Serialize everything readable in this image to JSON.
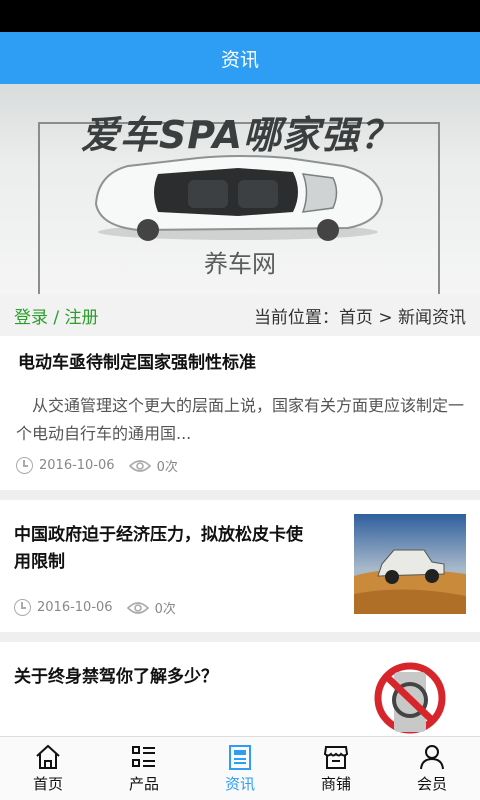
{
  "header": {
    "title": "资讯"
  },
  "banner": {
    "headline": "爱车SPA哪家强？",
    "caption": "养车网"
  },
  "breadcrumb": {
    "login": "登录",
    "separator": " / ",
    "register": "注册",
    "prefix": "当前位置：",
    "home": "首页",
    "arrow": " > ",
    "current": "新闻资讯"
  },
  "articles": [
    {
      "title": "电动车亟待制定国家强制性标准",
      "summary": "　从交通管理这个更大的层面上说，国家有关方面更应该制定一个电动自行车的通用国...",
      "date": "2016-10-06",
      "views": "0次"
    },
    {
      "title": "中国政府迫于经济压力，拟放松皮卡使用限制",
      "date": "2016-10-06",
      "views": "0次"
    },
    {
      "title": "关于终身禁驾你了解多少？"
    }
  ],
  "tabs": [
    {
      "label": "首页",
      "icon": "home-icon"
    },
    {
      "label": "产品",
      "icon": "list-icon"
    },
    {
      "label": "资讯",
      "icon": "news-icon",
      "active": true
    },
    {
      "label": "商铺",
      "icon": "shop-icon"
    },
    {
      "label": "会员",
      "icon": "user-icon"
    }
  ],
  "colors": {
    "primary": "#2e9ef5",
    "auth_green": "#2a9f2a",
    "status_bar": "#000000"
  }
}
